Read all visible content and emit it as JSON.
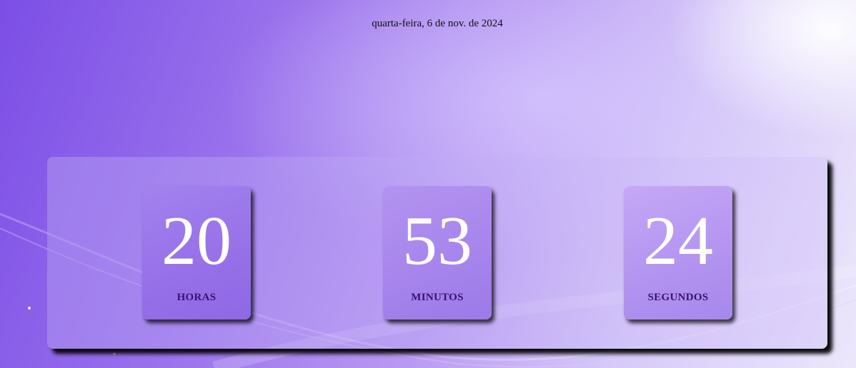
{
  "date": "quarta-feira, 6 de nov. de 2024",
  "clock": {
    "hours": {
      "value": "20",
      "label": "HORAS"
    },
    "minutes": {
      "value": "53",
      "label": "MINUTOS"
    },
    "seconds": {
      "value": "24",
      "label": "SEGUNDOS"
    }
  },
  "colors": {
    "background_start": "#7c4ee6",
    "background_end": "#ece7fb",
    "number_text": "#ffffff",
    "label_text": "#3a1270"
  }
}
